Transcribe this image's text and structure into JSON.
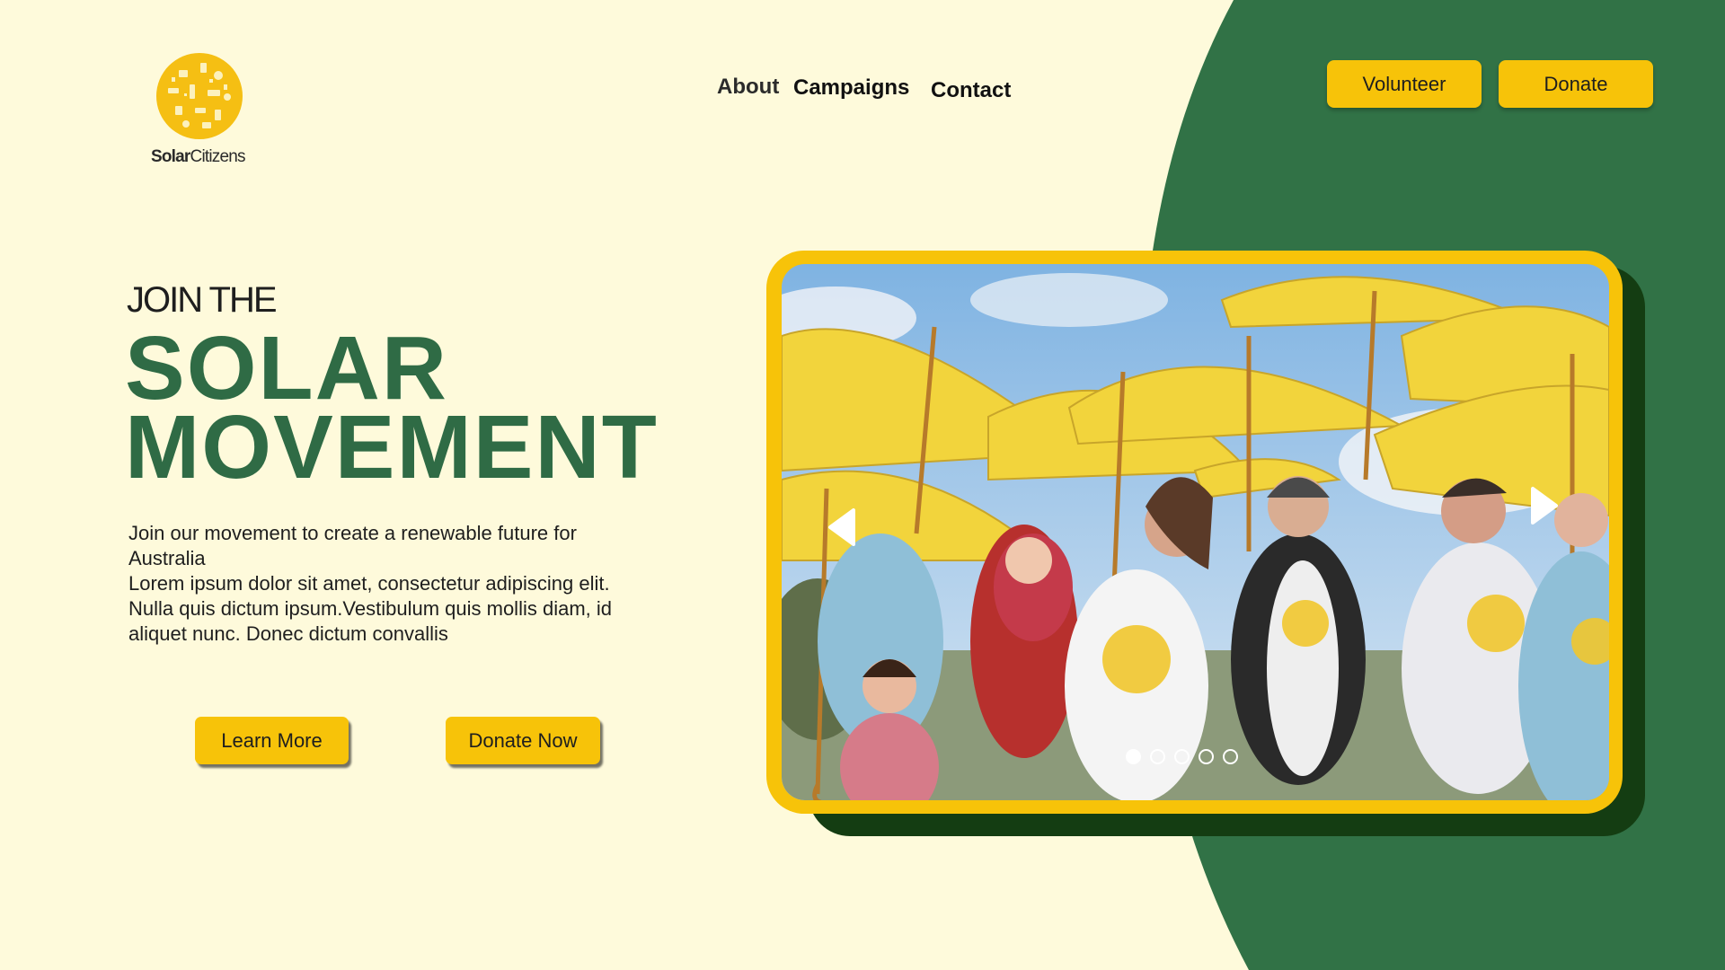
{
  "brand": {
    "logo_bold": "Solar",
    "logo_light": "Citizens",
    "accent": "#f7c309",
    "green": "#2f6b45",
    "dark_green": "#143d12",
    "background": "#fefadb"
  },
  "nav": {
    "about": "About",
    "campaigns": "Campaigns",
    "contact": "Contact"
  },
  "header_buttons": {
    "volunteer": "Volunteer",
    "donate": "Donate"
  },
  "hero": {
    "kicker": "JOIN THE",
    "title_line1": "SOLAR",
    "title_line2": "MOVEMENT",
    "desc_line1": "Join our movement to create a renewable future for Australia",
    "desc_line2": "Lorem ipsum dolor sit amet, consectetur adipiscing elit. Nulla quis dictum ipsum.Vestibulum quis mollis diam, id aliquet nunc. Donec dictum convallis",
    "learn_more": "Learn More",
    "donate_now": "Donate Now"
  },
  "carousel": {
    "slide_count": 5,
    "active_slide": 1,
    "icons": [
      "arrow-left-icon",
      "arrow-right-icon"
    ]
  }
}
